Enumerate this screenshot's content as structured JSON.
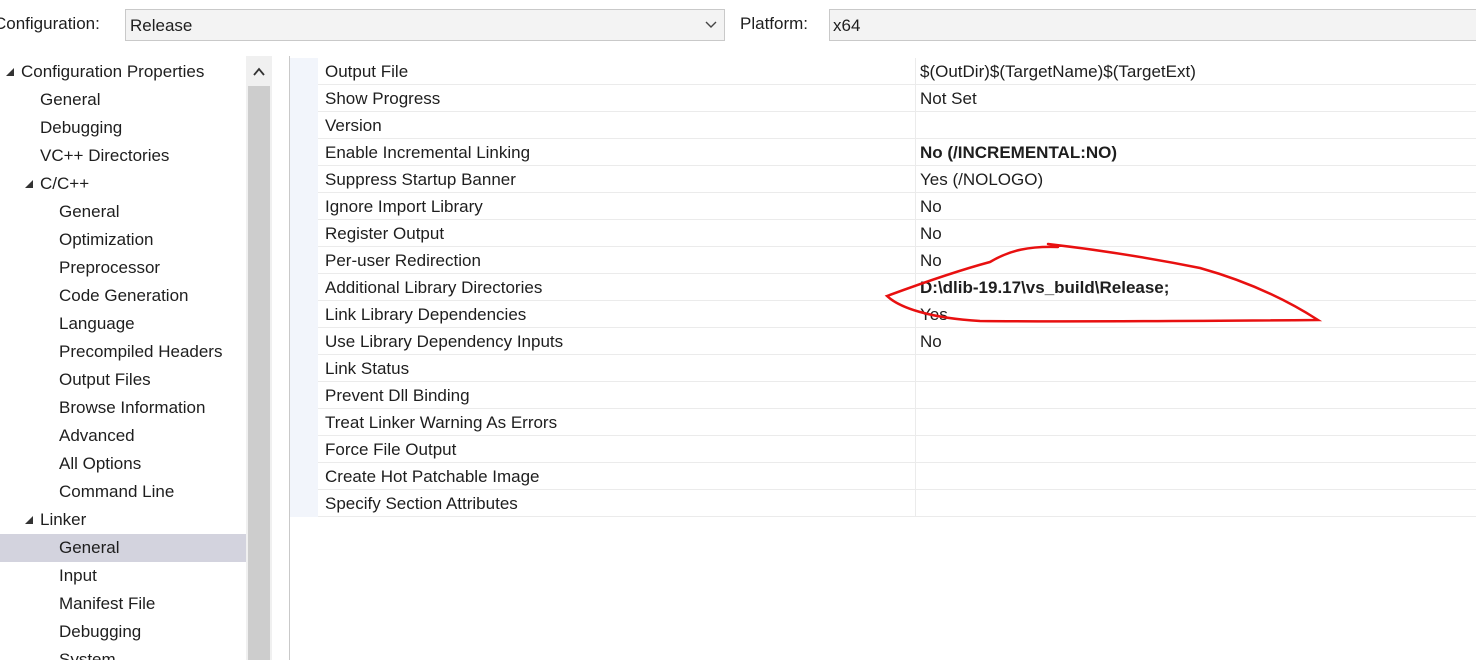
{
  "toolbar": {
    "configuration_label": "Configuration:",
    "configuration_value": "Release",
    "platform_label": "Platform:",
    "platform_value": "x64"
  },
  "tree": [
    {
      "label": "Configuration Properties",
      "level": 0,
      "expanded": true
    },
    {
      "label": "General",
      "level": 1
    },
    {
      "label": "Debugging",
      "level": 1
    },
    {
      "label": "VC++ Directories",
      "level": 1
    },
    {
      "label": "C/C++",
      "level": 1,
      "expanded": true
    },
    {
      "label": "General",
      "level": 2
    },
    {
      "label": "Optimization",
      "level": 2
    },
    {
      "label": "Preprocessor",
      "level": 2
    },
    {
      "label": "Code Generation",
      "level": 2
    },
    {
      "label": "Language",
      "level": 2
    },
    {
      "label": "Precompiled Headers",
      "level": 2
    },
    {
      "label": "Output Files",
      "level": 2
    },
    {
      "label": "Browse Information",
      "level": 2
    },
    {
      "label": "Advanced",
      "level": 2
    },
    {
      "label": "All Options",
      "level": 2
    },
    {
      "label": "Command Line",
      "level": 2
    },
    {
      "label": "Linker",
      "level": 1,
      "expanded": true
    },
    {
      "label": "General",
      "level": 2,
      "selected": true
    },
    {
      "label": "Input",
      "level": 2
    },
    {
      "label": "Manifest File",
      "level": 2
    },
    {
      "label": "Debugging",
      "level": 2
    },
    {
      "label": "System",
      "level": 2
    }
  ],
  "properties": [
    {
      "name": "Output File",
      "value": "$(OutDir)$(TargetName)$(TargetExt)"
    },
    {
      "name": "Show Progress",
      "value": "Not Set"
    },
    {
      "name": "Version",
      "value": ""
    },
    {
      "name": "Enable Incremental Linking",
      "value": "No (/INCREMENTAL:NO)",
      "bold": true
    },
    {
      "name": "Suppress Startup Banner",
      "value": "Yes (/NOLOGO)"
    },
    {
      "name": "Ignore Import Library",
      "value": "No"
    },
    {
      "name": "Register Output",
      "value": "No"
    },
    {
      "name": "Per-user Redirection",
      "value": "No"
    },
    {
      "name": "Additional Library Directories",
      "value": "D:\\dlib-19.17\\vs_build\\Release;",
      "bold": true
    },
    {
      "name": "Link Library Dependencies",
      "value": "Yes"
    },
    {
      "name": "Use Library Dependency Inputs",
      "value": "No"
    },
    {
      "name": "Link Status",
      "value": ""
    },
    {
      "name": "Prevent Dll Binding",
      "value": ""
    },
    {
      "name": "Treat Linker Warning As Errors",
      "value": ""
    },
    {
      "name": "Force File Output",
      "value": ""
    },
    {
      "name": "Create Hot Patchable Image",
      "value": ""
    },
    {
      "name": "Specify Section Attributes",
      "value": ""
    }
  ],
  "colors": {
    "selection": "#d3d3de",
    "annotation": "#e81010",
    "gutter": "#f2f5fb"
  },
  "icons": {
    "dropdown": "chevron-down-icon",
    "expander": "expanded-triangle-icon",
    "scroll": "chevron-up-icon"
  }
}
